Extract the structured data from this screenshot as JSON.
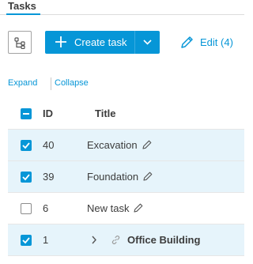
{
  "tabs": {
    "active_label": "Tasks"
  },
  "toolbar": {
    "tree_view_icon": "tree-structure-icon",
    "create_label": "Create task",
    "edit_label": "Edit (4)"
  },
  "links": {
    "expand": "Expand",
    "collapse": "Collapse"
  },
  "table": {
    "columns": {
      "id": "ID",
      "title": "Title"
    },
    "rows": [
      {
        "id": "40",
        "title": "Excavation",
        "checked": true
      },
      {
        "id": "39",
        "title": "Foundation",
        "checked": true
      },
      {
        "id": "6",
        "title": "New task",
        "checked": false
      },
      {
        "id": "1",
        "title": "Office Building",
        "checked": true
      }
    ]
  },
  "colors": {
    "accent": "#0696d7",
    "selected_row": "#e6f4fb"
  }
}
